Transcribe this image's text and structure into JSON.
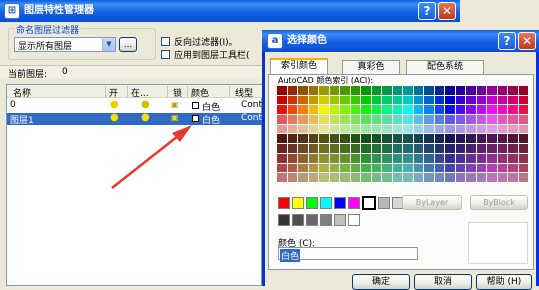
{
  "layer_manager": {
    "title": "图层特性管理器",
    "filter_group_label": "命名图层过滤器",
    "filter_select_value": "显示所有图层",
    "more_button": "...",
    "invert_filter": "反向过滤器(I)。",
    "apply_to_toolbar": "应用到图层工具栏(",
    "current_layer_label": "当前图层:",
    "current_layer_value": "0",
    "columns": [
      "名称",
      "开",
      "在...",
      "锁",
      "颜色",
      "线型"
    ],
    "rows": [
      {
        "name": "0",
        "color": "白色",
        "linetype": "Cont",
        "selected": false
      },
      {
        "name": "图层1",
        "color": "白色",
        "linetype": "Cont",
        "selected": true
      }
    ]
  },
  "color_dialog": {
    "title": "选择颜色",
    "tabs": [
      "索引颜色",
      "真彩色",
      "配色系统"
    ],
    "aci_label": "AutoCAD 颜色索引 (ACI):",
    "bylayer": "ByLayer",
    "byblock": "ByBlock",
    "color_label": "颜色 (C):",
    "color_value": "白色",
    "ok": "确定",
    "cancel": "取消",
    "help": "帮助 (H)"
  },
  "standard_colors": [
    "#ff0000",
    "#ffff00",
    "#00ff00",
    "#00ffff",
    "#0000ff",
    "#ff00ff",
    "#ffffff"
  ],
  "gray_colors": [
    "#333333",
    "#505050",
    "#696969",
    "#808080",
    "#c0c0c0",
    "#ffffff"
  ],
  "annotation_color": "#e23a2e"
}
